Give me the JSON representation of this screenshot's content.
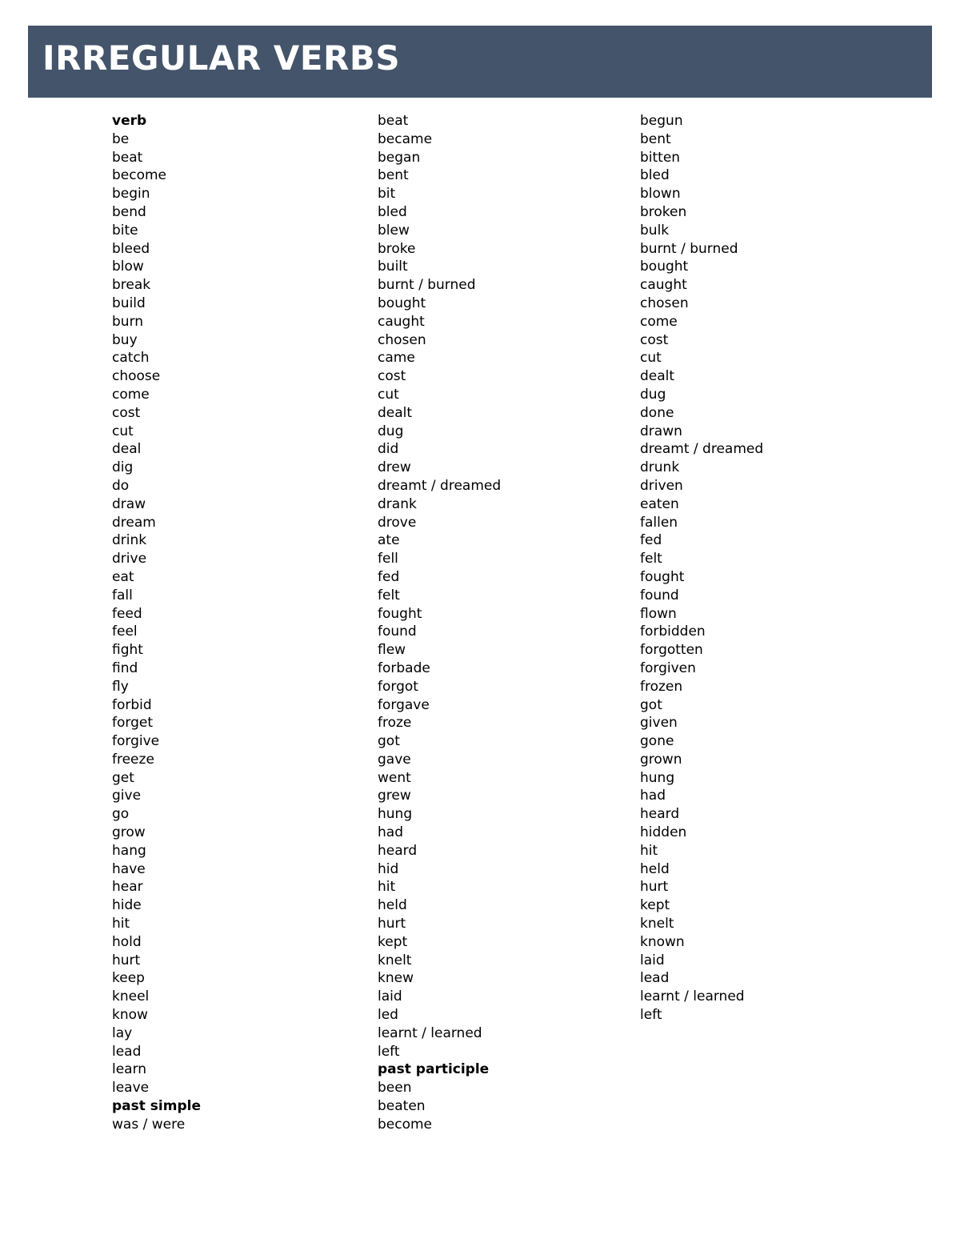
{
  "document": {
    "banner": {
      "title": "IRREGULAR VERBS",
      "background_color": "#44546A",
      "text_color": "#FFFFFF"
    }
  },
  "columns": [
    {
      "id": "verb",
      "heading": "verb",
      "entries": [
        "verb",
        "be",
        "beat",
        "become",
        "begin",
        "bend",
        "bite",
        "bleed",
        "blow",
        "break",
        "build",
        "burn",
        "buy",
        "catch",
        "choose",
        "come",
        "cost",
        "cut",
        "deal",
        "dig",
        "do",
        "draw",
        "dream",
        "drink",
        "drive",
        "eat",
        "fall",
        "feed",
        "feel",
        "fight",
        "find",
        "fly",
        "forbid",
        "forget",
        "forgive",
        "freeze",
        "get",
        "give",
        "go",
        "grow",
        "hang",
        "have",
        "hear",
        "hide",
        "hit",
        "hold",
        "hurt",
        "keep",
        "kneel",
        "know",
        "lay",
        "lead",
        "learn",
        "leave",
        "past simple",
        "was / were"
      ],
      "bold_rows": [
        0,
        54
      ]
    },
    {
      "id": "past-simple",
      "heading": "past simple",
      "entries": [
        "beat",
        "became",
        "began",
        "bent",
        "bit",
        "bled",
        "blew",
        "broke",
        "built",
        "burnt / burned",
        "bought",
        "caught",
        "chosen",
        "came",
        "cost",
        "cut",
        "dealt",
        "dug",
        "did",
        "drew",
        "dreamt / dreamed",
        "drank",
        "drove",
        "ate",
        "fell",
        "fed",
        "felt",
        "fought",
        "found",
        "flew",
        "forbade",
        "forgot",
        "forgave",
        "froze",
        "got",
        "gave",
        "went",
        "grew",
        "hung",
        "had",
        "heard",
        "hid",
        "hit",
        "held",
        "hurt",
        "kept",
        "knelt",
        "knew",
        "laid",
        "led",
        "learnt / learned",
        "left",
        "past participle",
        "been",
        "beaten",
        "become"
      ],
      "bold_rows": [
        52
      ]
    },
    {
      "id": "past-participle",
      "heading": "past participle",
      "entries": [
        "begun",
        "bent",
        "bitten",
        "bled",
        "blown",
        "broken",
        "bulk",
        "burnt / burned",
        "bought",
        "caught",
        "chosen",
        "come",
        "cost",
        "cut",
        "dealt",
        "dug",
        "done",
        "drawn",
        "dreamt / dreamed",
        "drunk",
        "driven",
        "eaten",
        "fallen",
        "fed",
        "felt",
        "fought",
        "found",
        "flown",
        "forbidden",
        "forgotten",
        "forgiven",
        "frozen",
        "got",
        "given",
        "gone",
        "grown",
        "hung",
        "had",
        "heard",
        "hidden",
        "hit",
        "held",
        "hurt",
        "kept",
        "knelt",
        "known",
        "laid",
        "lead",
        "learnt / learned",
        "left"
      ],
      "bold_rows": []
    }
  ]
}
